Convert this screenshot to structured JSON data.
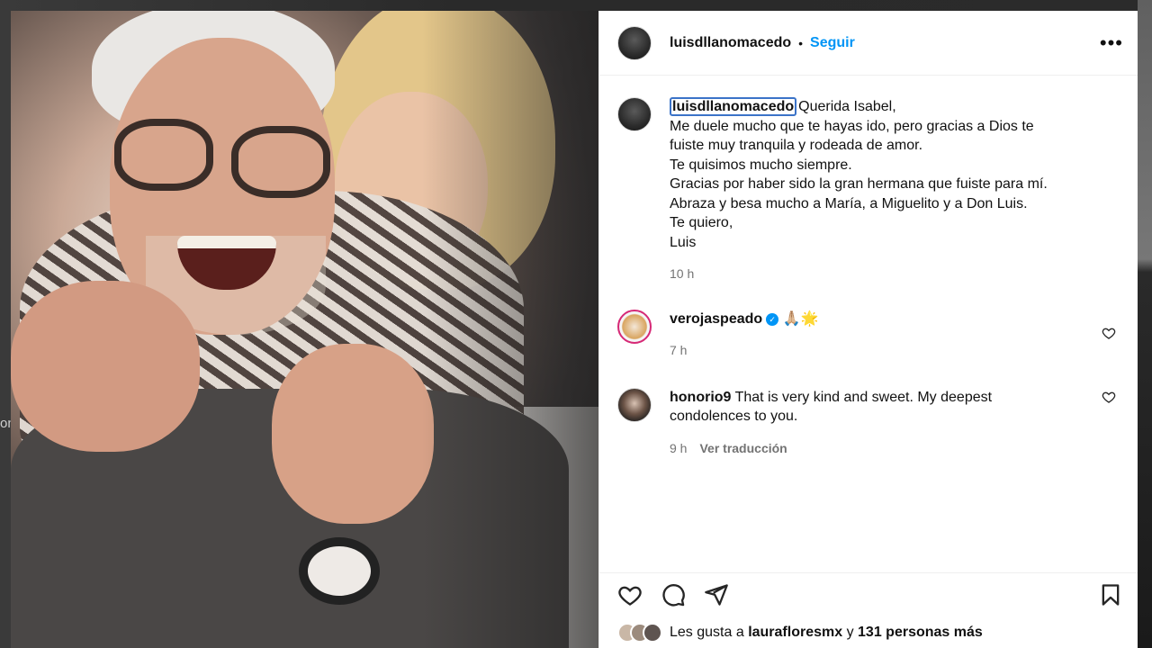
{
  "backdrop": {
    "left_text": "on"
  },
  "post": {
    "username": "luisdllanomacedo",
    "separator": "•",
    "follow_label": "Seguir",
    "more_label": "•••",
    "caption": {
      "username": "luisdllanomacedo",
      "lines": [
        "Querida Isabel,",
        "Me duele mucho que te hayas ido, pero gracias a Dios te",
        "fuiste muy tranquila y rodeada de amor.",
        "Te quisimos mucho siempre.",
        "Gracias por haber sido la gran hermana que fuiste para mí.",
        "Abraza y besa mucho a María, a Miguelito y a Don Luis.",
        "Te quiero,",
        "Luis"
      ],
      "time": "10 h"
    },
    "comments": [
      {
        "username": "verojaspeado",
        "verified": true,
        "text": "🙏🏼🌟",
        "time": "7 h"
      },
      {
        "username": "honorio9",
        "text_line1": "That is very kind and sweet. My deepest",
        "text_line2": "condolences to you.",
        "time": "9 h",
        "translate_label": "Ver traducción"
      }
    ],
    "likes": {
      "prefix": "Les gusta a",
      "user": "laurafloresmx",
      "joiner": "y",
      "others": "131 personas más"
    }
  },
  "colors": {
    "accent": "#0095f6",
    "text": "#111111",
    "muted": "#737373"
  }
}
